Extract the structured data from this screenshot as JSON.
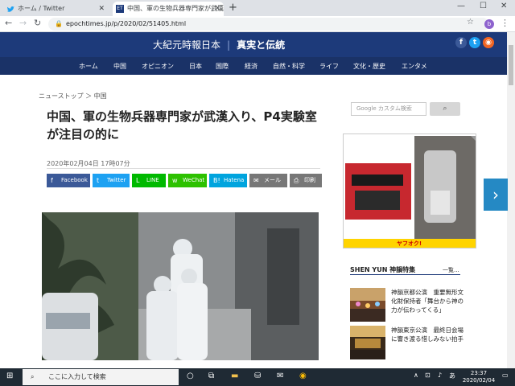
{
  "browser": {
    "tabs": [
      {
        "label": "ホーム / Twitter"
      },
      {
        "label": "中国、軍の生物兵器専門家が武漢"
      }
    ],
    "url": "epochtimes.jp/p/2020/02/51405.html",
    "profile_initial": "b"
  },
  "site": {
    "logo_cn": "大紀元時報日本",
    "logo_jp": "真実と伝統",
    "nav": [
      "ホーム",
      "中国",
      "オピニオン",
      "日本",
      "国際",
      "経済",
      "自然・科学",
      "ライフ",
      "文化・歴史",
      "エンタメ"
    ]
  },
  "article": {
    "breadcrumb": "ニューストップ ＞ 中国",
    "title": "中国、軍の生物兵器専門家が武漢入り、P4実験室が注目の的に",
    "date": "2020年02月04日 17時07分",
    "share": [
      {
        "label": "Facebook",
        "color": "#3b5998",
        "icon": "f"
      },
      {
        "label": "Twitter",
        "color": "#1da1f2",
        "icon": "t"
      },
      {
        "label": "LINE",
        "color": "#00b900",
        "icon": "L"
      },
      {
        "label": "WeChat",
        "color": "#2dc100",
        "icon": "w"
      },
      {
        "label": "Hatena",
        "color": "#00a4de",
        "icon": "B!"
      },
      {
        "label": "メール",
        "color": "#777777",
        "icon": "✉"
      },
      {
        "label": "印刷",
        "color": "#777777",
        "icon": "⎙"
      }
    ]
  },
  "sidebar": {
    "search_placeholder": "Google カスタム検索",
    "search_icon": "magnifier-icon",
    "ad_label": "ヤフオク!",
    "shenyun_title": "SHEN YUN 神韻特集",
    "shenyun_list": "一覧...",
    "items": [
      {
        "text": "神韻京都公演　重要無形文化財保持者「舞台から神の力が伝わってくる」"
      },
      {
        "text": "神韻東京公演　最終日会場に響き渡る惜しみない拍手"
      }
    ]
  },
  "taskbar": {
    "search_placeholder": "ここに入力して検索",
    "time": "23:37",
    "date": "2020/02/04"
  }
}
